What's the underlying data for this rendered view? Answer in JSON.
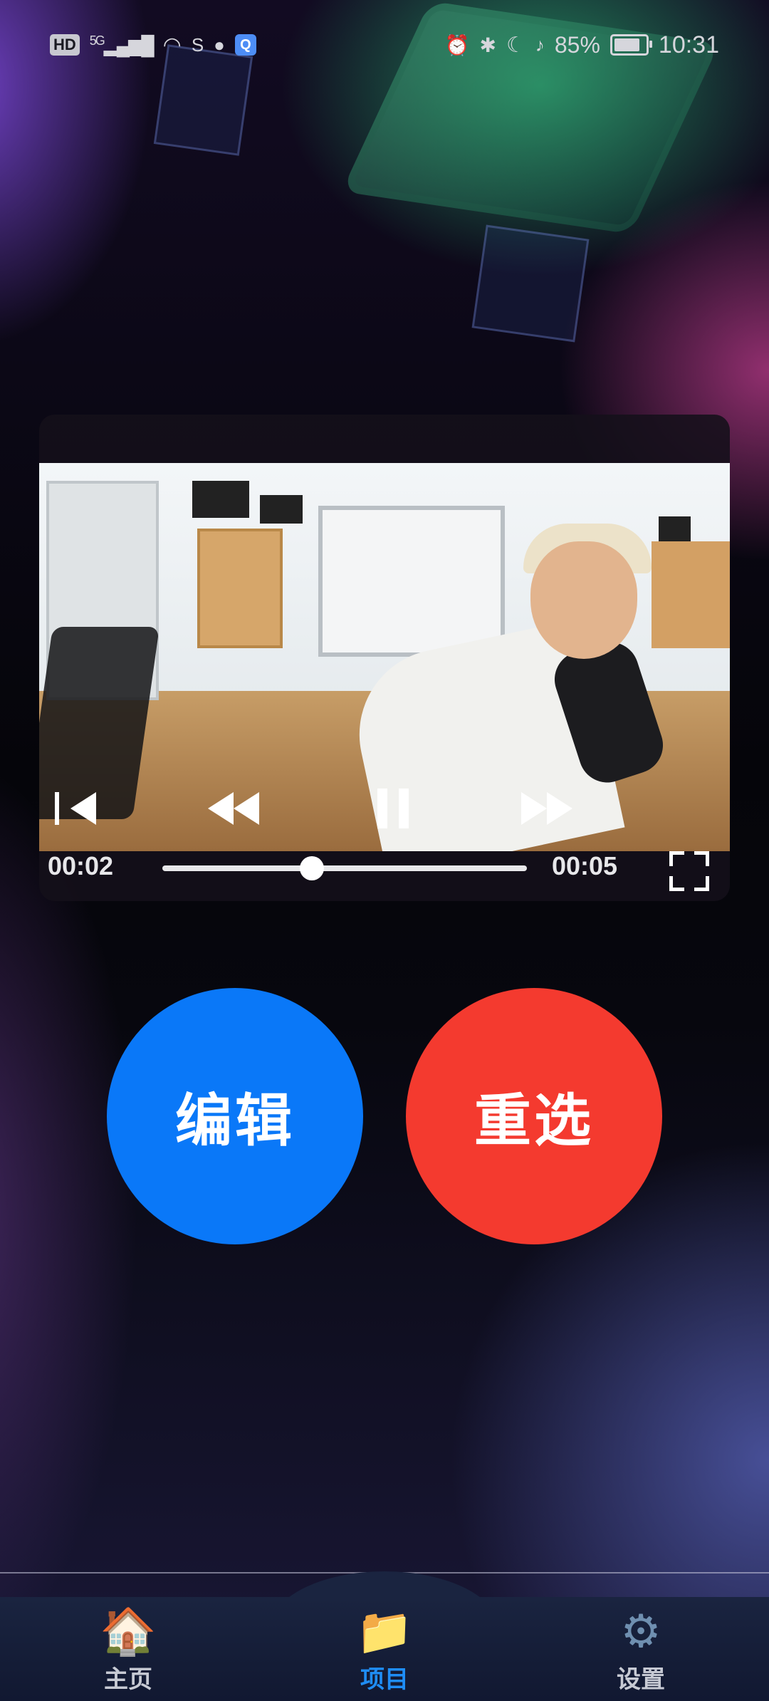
{
  "status_bar": {
    "hd_badge": "HD",
    "network": "5G",
    "battery_percent": "85%",
    "battery_level": 0.85,
    "time": "10:31"
  },
  "player": {
    "current_time": "00:02",
    "duration": "00:05",
    "progress": 0.41,
    "icons": {
      "previous": "skip-previous-icon",
      "rewind": "rewind-icon",
      "pause": "pause-icon",
      "forward": "fast-forward-icon",
      "fullscreen": "fullscreen-icon"
    }
  },
  "actions": {
    "edit_label": "编辑",
    "reselect_label": "重选",
    "edit_color": "#0a78f8",
    "reselect_color": "#f43a2f"
  },
  "tabs": [
    {
      "label": "主页",
      "icon": "house-icon",
      "active": false
    },
    {
      "label": "项目",
      "icon": "folder-icon",
      "active": true
    },
    {
      "label": "设置",
      "icon": "gear-icon",
      "active": false
    }
  ],
  "colors": {
    "active_tab": "#1f8df5",
    "inactive_tab": "#c7cad4"
  }
}
